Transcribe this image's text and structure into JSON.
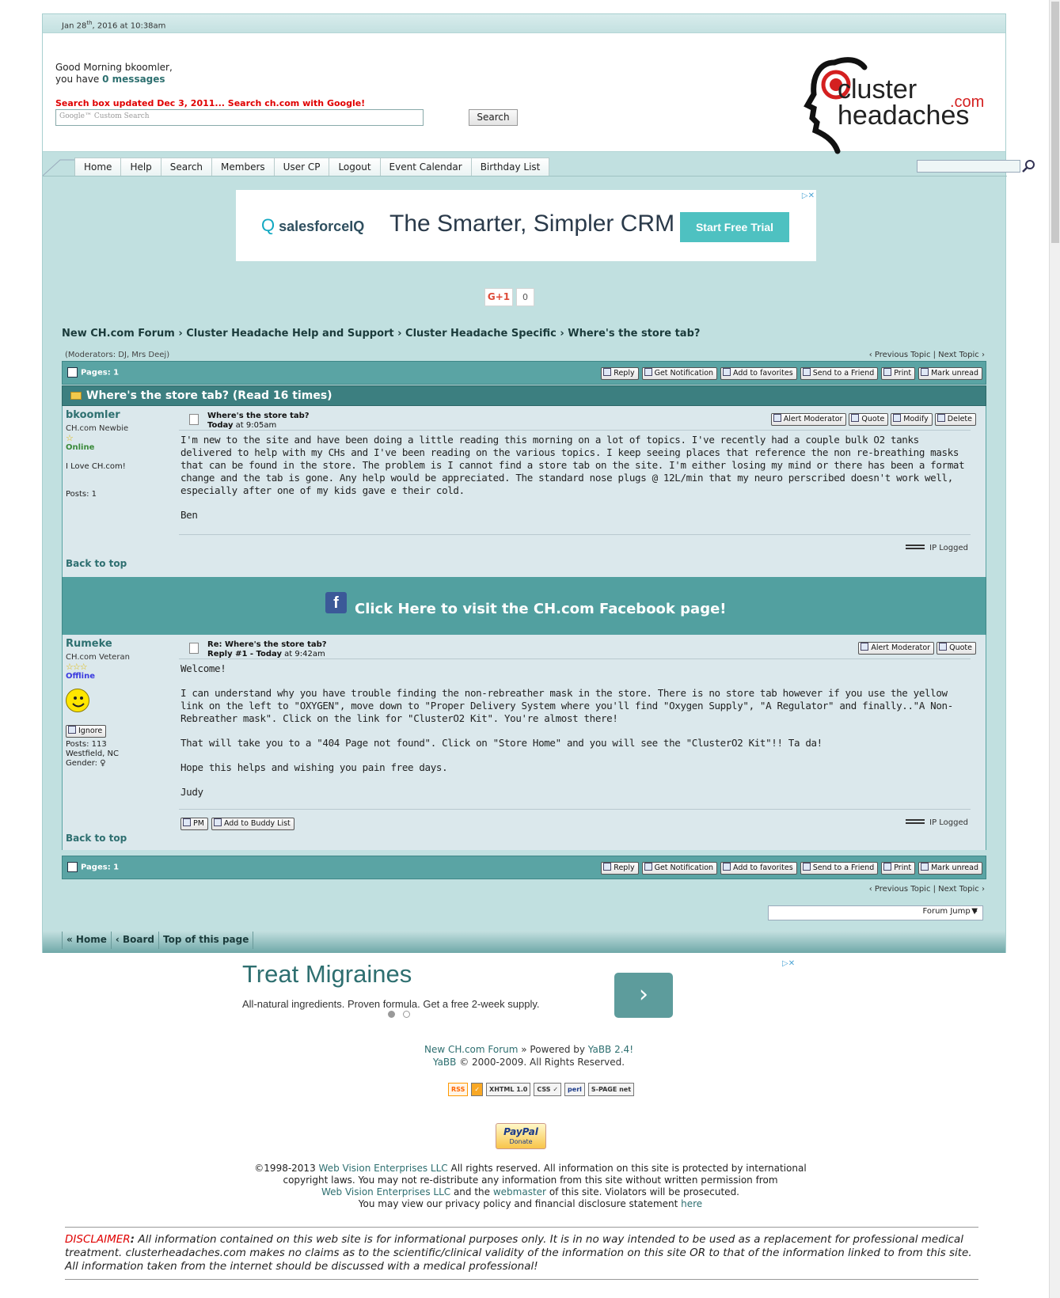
{
  "header": {
    "date_prefix": "Jan 28",
    "date_sup": "th",
    "date_suffix": ", 2016 at 10:38am",
    "greeting": "Good Morning bkoomler,",
    "you_have": "you have ",
    "messages": "0 messages",
    "search_notice": "Search box updated Dec 3, 2011... Search ch.com with Google!",
    "search_placeholder": "Google™ Custom Search",
    "search_button": "Search",
    "logo": {
      "word1": "cluster",
      "word2": "headaches",
      "dotcom": ".com"
    }
  },
  "menu": [
    "Home",
    "Help",
    "Search",
    "Members",
    "User CP",
    "Logout",
    "Event Calendar",
    "Birthday List"
  ],
  "ad_top": {
    "brand_pre": "salesforce",
    "brand_post": "IQ",
    "tagline": "The Smarter, Simpler CRM",
    "cta": "Start Free Trial",
    "adchoices": "▷✕"
  },
  "social": {
    "gplus": "G+1",
    "count": "0"
  },
  "breadcrumb": "New CH.com Forum › Cluster Headache Help and Support › Cluster Headache Specific › Where's the store tab?",
  "moderators": "(Moderators: DJ, Mrs Deej)",
  "prev_next": "‹ Previous Topic | Next Topic ›",
  "pages_label": "Pages: 1",
  "thread_actions": [
    "Reply",
    "Get Notification",
    "Add to favorites",
    "Send to a Friend",
    "Print",
    "Mark unread"
  ],
  "thread_title": "Where's the store tab? (Read 16 times)",
  "posts": [
    {
      "author": "bkoomler",
      "rank": "CH.com Newbie",
      "stars": "☆",
      "status": "Online",
      "personal": "I Love CH.com!",
      "posts": "Posts: 1",
      "subject": "Where's the store tab?",
      "date_bold": "Today",
      "date_rest": " at 9:05am",
      "actions": [
        "Alert Moderator",
        "Quote",
        "Modify",
        "Delete"
      ],
      "body": [
        "I'm new to the site and have been doing a little reading this morning on a lot of topics. I've recently had a couple bulk O2 tanks delivered to help with my CHs and I've been reading on the various topics. I keep seeing places that reference the non re-breathing masks that can be found in the store. The problem is I cannot find a store tab on the site. I'm either losing my mind or there has been a format change and the tab is gone. Any help would be appreciated. The standard nose plugs @ 12L/min that my neuro perscribed doesn't work well, especially after one of my kids gave e their cold.",
        "Ben"
      ],
      "ip_logged": "IP Logged",
      "back_to_top": "Back to top"
    },
    {
      "author": "Rumeke",
      "rank": "CH.com Veteran",
      "stars": "☆☆☆",
      "status": "Offline",
      "ignore": "Ignore",
      "posts": "Posts: 113",
      "location": "Westfield, NC",
      "gender": "Gender: ♀",
      "subject": "Re: Where's the store tab?",
      "date_bold": "Reply #1 - Today",
      "date_rest": " at 9:42am",
      "actions": [
        "Alert Moderator",
        "Quote"
      ],
      "body": [
        "Welcome!",
        "I can understand why you have trouble finding the non-rebreather mask in the store. There is no store tab however if you use the yellow link on the left to \"OXYGEN\", move down to \"Proper Delivery System where you'll find \"Oxygen Supply\", \"A Regulator\" and finally..\"A Non-Rebreather mask\". Click on the link for \"ClusterO2 Kit\". You're almost there!",
        "That will take you to a \"404 Page not found\". Click on \"Store Home\" and you will see the \"ClusterO2 Kit\"!! Ta da!",
        "Hope this helps and wishing you pain free days.",
        "Judy"
      ],
      "pm": "PM",
      "buddy": "Add to Buddy List",
      "ip_logged": "IP Logged",
      "back_to_top": "Back to top"
    }
  ],
  "facebook_cta": "Click Here to visit the CH.com Facebook page!",
  "facebook_glyph": "f",
  "forum_jump": "Forum Jump »",
  "forum_jump_arrow": "▼",
  "footer_nav": [
    "« Home",
    "‹ Board",
    "Top of this page"
  ],
  "ad_bottom": {
    "title": "Treat Migraines",
    "sub": "All-natural ingredients. Proven formula. Get a free 2-week supply.",
    "arrow": "›",
    "adchoices": "▷✕"
  },
  "powered": {
    "forum": "New CH.com Forum",
    "sep": " » Powered by ",
    "yabb": "YaBB 2.4!",
    "line2_link": "YaBB",
    "line2": " © 2000-2009. All Rights Reserved."
  },
  "badges": [
    "RSS",
    "✓",
    "XHTML 1.0",
    "CSS ✓",
    "perl",
    "S-PAGE net"
  ],
  "paypal": {
    "brand": "PayPal",
    "donate": "Donate"
  },
  "copyright": {
    "l1a": "©1998-2013 ",
    "l1link": "Web Vision Enterprises LLC",
    "l1b": " All rights reserved. All information on this site is protected by international",
    "l2": "copyright laws. You may not re-distribute any information from this site without written permission from",
    "l3link1": "Web Vision Enterprises LLC",
    "l3mid": " and the ",
    "l3link2": "webmaster",
    "l3end": " of this site. Violators will be prosecuted.",
    "l4a": "You may view our privacy policy and financial disclosure statement ",
    "l4link": "here"
  },
  "disclaimer": {
    "label": "DISCLAIMER",
    "colon": ":",
    "text": " All information contained on this web site is for informational purposes only.  It is in no way intended to be used as a replacement for professional medical treatment.   clusterheadaches.com makes no claims as to the scientific/clinical validity of the information on this site OR to that of the information linked to from this site.  All information taken from the internet should be discussed with a medical professional!"
  },
  "colors": {
    "frame": "#c1e0e0",
    "bar": "#5aa4a4",
    "title_bar": "#3c7f80",
    "post_bg": "#dbe8ec",
    "link": "#2e6f70",
    "alert": "#e00000"
  }
}
